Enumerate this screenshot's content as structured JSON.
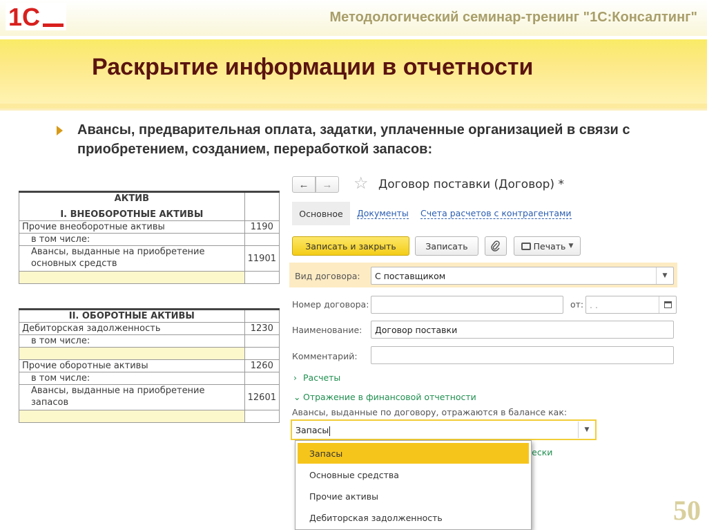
{
  "header": {
    "logo_text": "1С",
    "seminar": "Методологический семинар-тренинг \"1С:Консалтинг\"",
    "title": "Раскрытие информации в отчетности"
  },
  "bullet": "Авансы, предварительная оплата, задатки, уплаченные организацией в связи с приобретением, созданием, переработкой запасов:",
  "balance_table_1": {
    "heading": "АКТИВ",
    "section": "I. ВНЕОБОРОТНЫЕ АКТИВЫ",
    "rows": [
      {
        "label": "Прочие внеоборотные активы",
        "code": "1190"
      },
      {
        "label": "в том числе:",
        "code": ""
      },
      {
        "label": "Авансы, выданные на приобретение основных средств",
        "code": "11901"
      }
    ]
  },
  "balance_table_2": {
    "section": "II. ОБОРОТНЫЕ АКТИВЫ",
    "rows": [
      {
        "label": "Дебиторская задолженность",
        "code": "1230"
      },
      {
        "label": "в том числе:",
        "code": ""
      },
      {
        "label": "Прочие оборотные активы",
        "code": "1260"
      },
      {
        "label": "в том числе:",
        "code": ""
      },
      {
        "label": "Авансы, выданные на приобретение запасов",
        "code": "12601"
      }
    ]
  },
  "form": {
    "nav_back": "←",
    "nav_forward": "→",
    "star": "☆",
    "title": "Договор поставки (Договор) *",
    "tabs": {
      "main": "Основное",
      "documents": "Документы",
      "accounts": "Счета расчетов с контрагентами"
    },
    "toolbar": {
      "save_close": "Записать и закрыть",
      "save": "Записать",
      "print": "Печать"
    },
    "fields": {
      "kind_label": "Вид договора:",
      "kind_value": "С поставщиком",
      "number_label": "Номер договора:",
      "number_value": "",
      "date_label": "от:",
      "date_value": "  .  .",
      "name_label": "Наименование:",
      "name_value": "Договор поставки",
      "comment_label": "Комментарий:",
      "comment_value": ""
    },
    "groups": {
      "payments": "Расчеты",
      "reporting": "Отражение в финансовой отчетности"
    },
    "reporting_caption": "Авансы, выданные по договору, отражаются в балансе как:",
    "reporting_value": "Запасы",
    "hidden_link_tail": "нески",
    "dropdown_options": [
      "Запасы",
      "Основные средства",
      "Прочие активы",
      "Дебиторская задолженность"
    ],
    "selected_option": "Запасы"
  },
  "page_number": "50",
  "colors": {
    "accent_yellow": "#f4cd16",
    "title_red": "#5a1410",
    "link_blue": "#2a5db0",
    "group_green": "#1f8f4f"
  },
  "icons": [
    "logo-1c",
    "back-arrow-icon",
    "forward-arrow-icon",
    "star-icon",
    "paperclip-icon",
    "printer-icon",
    "chevron-down-icon",
    "calendar-icon",
    "chevron-right-icon"
  ]
}
